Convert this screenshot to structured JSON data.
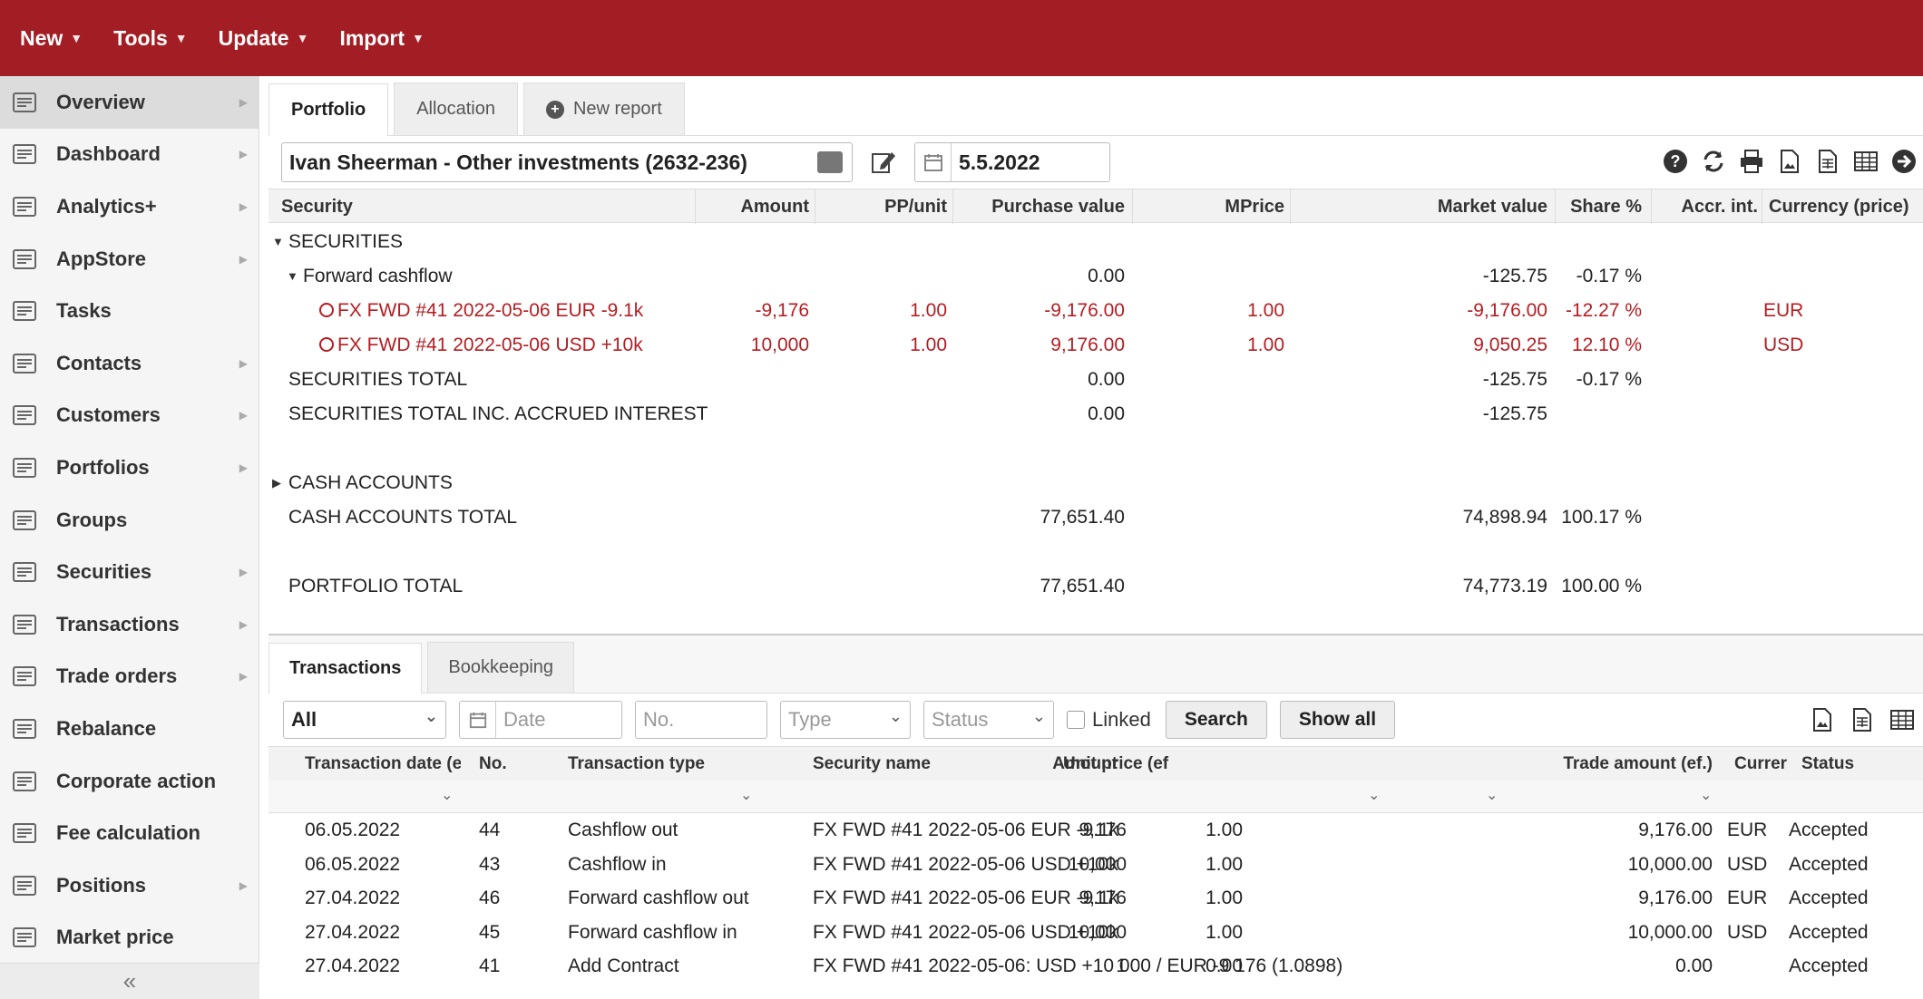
{
  "topmenu": [
    {
      "label": "New"
    },
    {
      "label": "Tools"
    },
    {
      "label": "Update"
    },
    {
      "label": "Import"
    }
  ],
  "sidebar": {
    "items": [
      {
        "label": "Overview",
        "icon": "overview-icon"
      },
      {
        "label": "Dashboard",
        "icon": "dashboard-icon"
      },
      {
        "label": "Analytics+",
        "icon": "analytics-icon"
      },
      {
        "label": "AppStore",
        "icon": "appstore-icon"
      },
      {
        "label": "Tasks",
        "icon": "tasks-icon"
      },
      {
        "label": "Contacts",
        "icon": "contacts-icon"
      },
      {
        "label": "Customers",
        "icon": "customers-icon"
      },
      {
        "label": "Portfolios",
        "icon": "portfolios-icon"
      },
      {
        "label": "Groups",
        "icon": "groups-icon"
      },
      {
        "label": "Securities",
        "icon": "securities-icon"
      },
      {
        "label": "Transactions",
        "icon": "transactions-icon"
      },
      {
        "label": "Trade orders",
        "icon": "cart-icon"
      },
      {
        "label": "Rebalance",
        "icon": "scale-icon"
      },
      {
        "label": "Corporate action",
        "icon": "building-icon"
      },
      {
        "label": "Fee calculation",
        "icon": "fee-icon"
      },
      {
        "label": "Positions",
        "icon": "positions-icon"
      },
      {
        "label": "Market price",
        "icon": "coins-icon"
      }
    ],
    "collapse": "«"
  },
  "tabs": [
    {
      "label": "Portfolio"
    },
    {
      "label": "Allocation"
    },
    {
      "label": "New report"
    }
  ],
  "toolbar": {
    "portfolio": "Ivan Sheerman - Other investments (2632-236)",
    "date": "5.5.2022"
  },
  "portfolio_table": {
    "headers": [
      "Security",
      "Amount",
      "PP/unit",
      "Purchase value",
      "MPrice",
      "Market value",
      "Share %",
      "Accr. int.",
      "Currency (price)"
    ],
    "rows": [
      {
        "security": "SECURITIES",
        "amount": "",
        "pp": "",
        "purchase": "",
        "mprice": "",
        "market": "",
        "share": "",
        "currency": ""
      },
      {
        "security": "Forward cashflow",
        "amount": "",
        "pp": "",
        "purchase": "0.00",
        "mprice": "",
        "market": "-125.75",
        "share": "-0.17 %",
        "currency": ""
      },
      {
        "security": "FX FWD #41 2022-05-06 EUR -9.1k",
        "amount": "-9,176",
        "pp": "1.00",
        "purchase": "-9,176.00",
        "mprice": "1.00",
        "market": "-9,176.00",
        "share": "-12.27 %",
        "currency": "EUR"
      },
      {
        "security": "FX FWD #41 2022-05-06 USD +10k",
        "amount": "10,000",
        "pp": "1.00",
        "purchase": "9,176.00",
        "mprice": "1.00",
        "market": "9,050.25",
        "share": "12.10 %",
        "currency": "USD"
      },
      {
        "security": "SECURITIES TOTAL",
        "amount": "",
        "pp": "",
        "purchase": "0.00",
        "mprice": "",
        "market": "-125.75",
        "share": "-0.17 %",
        "currency": ""
      },
      {
        "security": "SECURITIES TOTAL INC. ACCRUED INTEREST",
        "amount": "",
        "pp": "",
        "purchase": "0.00",
        "mprice": "",
        "market": "-125.75",
        "share": "",
        "currency": ""
      },
      {
        "security": "CASH ACCOUNTS",
        "amount": "",
        "pp": "",
        "purchase": "",
        "mprice": "",
        "market": "",
        "share": "",
        "currency": ""
      },
      {
        "security": "CASH ACCOUNTS TOTAL",
        "amount": "",
        "pp": "",
        "purchase": "77,651.40",
        "mprice": "",
        "market": "74,898.94",
        "share": "100.17 %",
        "currency": ""
      },
      {
        "security": "PORTFOLIO TOTAL",
        "amount": "",
        "pp": "",
        "purchase": "77,651.40",
        "mprice": "",
        "market": "74,773.19",
        "share": "100.00 %",
        "currency": ""
      }
    ]
  },
  "bottom_tabs": [
    {
      "label": "Transactions"
    },
    {
      "label": "Bookkeeping"
    }
  ],
  "filters": {
    "scope": "All",
    "date_placeholder": "Date",
    "no_placeholder": "No.",
    "type_placeholder": "Type",
    "status_placeholder": "Status",
    "linked": "Linked",
    "search": "Search",
    "show_all": "Show all"
  },
  "transactions": {
    "headers": [
      "Transaction date (ef",
      "No.",
      "Transaction type",
      "Security name",
      "Amount",
      "Unit price (ef",
      "Trade amount (ef.)",
      "Currer",
      "Status"
    ],
    "rows": [
      {
        "date": "06.05.2022",
        "no": "44",
        "type": "Cashflow out",
        "security": "FX FWD #41 2022-05-06 EUR -9.1k",
        "amount": "9,176",
        "unit": "1.00",
        "trade": "9,176.00",
        "cur": "EUR",
        "status": "Accepted"
      },
      {
        "date": "06.05.2022",
        "no": "43",
        "type": "Cashflow in",
        "security": "FX FWD #41 2022-05-06 USD +10k",
        "amount": "10,000",
        "unit": "1.00",
        "trade": "10,000.00",
        "cur": "USD",
        "status": "Accepted"
      },
      {
        "date": "27.04.2022",
        "no": "46",
        "type": "Forward cashflow out",
        "security": "FX FWD #41 2022-05-06 EUR -9.1k",
        "amount": "9,176",
        "unit": "1.00",
        "trade": "9,176.00",
        "cur": "EUR",
        "status": "Accepted"
      },
      {
        "date": "27.04.2022",
        "no": "45",
        "type": "Forward cashflow in",
        "security": "FX FWD #41 2022-05-06 USD +10k",
        "amount": "10,000",
        "unit": "1.00",
        "trade": "10,000.00",
        "cur": "USD",
        "status": "Accepted"
      },
      {
        "date": "27.04.2022",
        "no": "41",
        "type": "Add Contract",
        "security": "FX FWD #41 2022-05-06: USD +10 000 / EUR -9 176 (1.0898)",
        "amount": "1",
        "unit": "0.00",
        "trade": "0.00",
        "cur": "",
        "status": "Accepted"
      }
    ]
  },
  "colors": {
    "brand": "#a31d24",
    "negative": "#b51d22"
  }
}
